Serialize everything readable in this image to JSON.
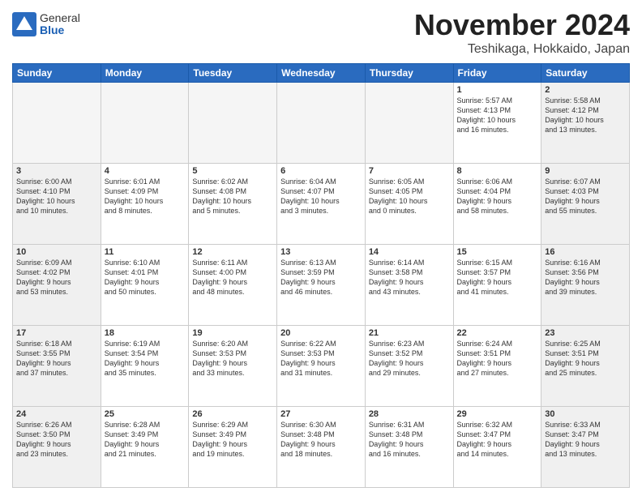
{
  "header": {
    "logo_general": "General",
    "logo_blue": "Blue",
    "month_title": "November 2024",
    "location": "Teshikaga, Hokkaido, Japan"
  },
  "days_of_week": [
    "Sunday",
    "Monday",
    "Tuesday",
    "Wednesday",
    "Thursday",
    "Friday",
    "Saturday"
  ],
  "weeks": [
    [
      {
        "day": "",
        "info": ""
      },
      {
        "day": "",
        "info": ""
      },
      {
        "day": "",
        "info": ""
      },
      {
        "day": "",
        "info": ""
      },
      {
        "day": "",
        "info": ""
      },
      {
        "day": "1",
        "info": "Sunrise: 5:57 AM\nSunset: 4:13 PM\nDaylight: 10 hours\nand 16 minutes."
      },
      {
        "day": "2",
        "info": "Sunrise: 5:58 AM\nSunset: 4:12 PM\nDaylight: 10 hours\nand 13 minutes."
      }
    ],
    [
      {
        "day": "3",
        "info": "Sunrise: 6:00 AM\nSunset: 4:10 PM\nDaylight: 10 hours\nand 10 minutes."
      },
      {
        "day": "4",
        "info": "Sunrise: 6:01 AM\nSunset: 4:09 PM\nDaylight: 10 hours\nand 8 minutes."
      },
      {
        "day": "5",
        "info": "Sunrise: 6:02 AM\nSunset: 4:08 PM\nDaylight: 10 hours\nand 5 minutes."
      },
      {
        "day": "6",
        "info": "Sunrise: 6:04 AM\nSunset: 4:07 PM\nDaylight: 10 hours\nand 3 minutes."
      },
      {
        "day": "7",
        "info": "Sunrise: 6:05 AM\nSunset: 4:05 PM\nDaylight: 10 hours\nand 0 minutes."
      },
      {
        "day": "8",
        "info": "Sunrise: 6:06 AM\nSunset: 4:04 PM\nDaylight: 9 hours\nand 58 minutes."
      },
      {
        "day": "9",
        "info": "Sunrise: 6:07 AM\nSunset: 4:03 PM\nDaylight: 9 hours\nand 55 minutes."
      }
    ],
    [
      {
        "day": "10",
        "info": "Sunrise: 6:09 AM\nSunset: 4:02 PM\nDaylight: 9 hours\nand 53 minutes."
      },
      {
        "day": "11",
        "info": "Sunrise: 6:10 AM\nSunset: 4:01 PM\nDaylight: 9 hours\nand 50 minutes."
      },
      {
        "day": "12",
        "info": "Sunrise: 6:11 AM\nSunset: 4:00 PM\nDaylight: 9 hours\nand 48 minutes."
      },
      {
        "day": "13",
        "info": "Sunrise: 6:13 AM\nSunset: 3:59 PM\nDaylight: 9 hours\nand 46 minutes."
      },
      {
        "day": "14",
        "info": "Sunrise: 6:14 AM\nSunset: 3:58 PM\nDaylight: 9 hours\nand 43 minutes."
      },
      {
        "day": "15",
        "info": "Sunrise: 6:15 AM\nSunset: 3:57 PM\nDaylight: 9 hours\nand 41 minutes."
      },
      {
        "day": "16",
        "info": "Sunrise: 6:16 AM\nSunset: 3:56 PM\nDaylight: 9 hours\nand 39 minutes."
      }
    ],
    [
      {
        "day": "17",
        "info": "Sunrise: 6:18 AM\nSunset: 3:55 PM\nDaylight: 9 hours\nand 37 minutes."
      },
      {
        "day": "18",
        "info": "Sunrise: 6:19 AM\nSunset: 3:54 PM\nDaylight: 9 hours\nand 35 minutes."
      },
      {
        "day": "19",
        "info": "Sunrise: 6:20 AM\nSunset: 3:53 PM\nDaylight: 9 hours\nand 33 minutes."
      },
      {
        "day": "20",
        "info": "Sunrise: 6:22 AM\nSunset: 3:53 PM\nDaylight: 9 hours\nand 31 minutes."
      },
      {
        "day": "21",
        "info": "Sunrise: 6:23 AM\nSunset: 3:52 PM\nDaylight: 9 hours\nand 29 minutes."
      },
      {
        "day": "22",
        "info": "Sunrise: 6:24 AM\nSunset: 3:51 PM\nDaylight: 9 hours\nand 27 minutes."
      },
      {
        "day": "23",
        "info": "Sunrise: 6:25 AM\nSunset: 3:51 PM\nDaylight: 9 hours\nand 25 minutes."
      }
    ],
    [
      {
        "day": "24",
        "info": "Sunrise: 6:26 AM\nSunset: 3:50 PM\nDaylight: 9 hours\nand 23 minutes."
      },
      {
        "day": "25",
        "info": "Sunrise: 6:28 AM\nSunset: 3:49 PM\nDaylight: 9 hours\nand 21 minutes."
      },
      {
        "day": "26",
        "info": "Sunrise: 6:29 AM\nSunset: 3:49 PM\nDaylight: 9 hours\nand 19 minutes."
      },
      {
        "day": "27",
        "info": "Sunrise: 6:30 AM\nSunset: 3:48 PM\nDaylight: 9 hours\nand 18 minutes."
      },
      {
        "day": "28",
        "info": "Sunrise: 6:31 AM\nSunset: 3:48 PM\nDaylight: 9 hours\nand 16 minutes."
      },
      {
        "day": "29",
        "info": "Sunrise: 6:32 AM\nSunset: 3:47 PM\nDaylight: 9 hours\nand 14 minutes."
      },
      {
        "day": "30",
        "info": "Sunrise: 6:33 AM\nSunset: 3:47 PM\nDaylight: 9 hours\nand 13 minutes."
      }
    ]
  ]
}
